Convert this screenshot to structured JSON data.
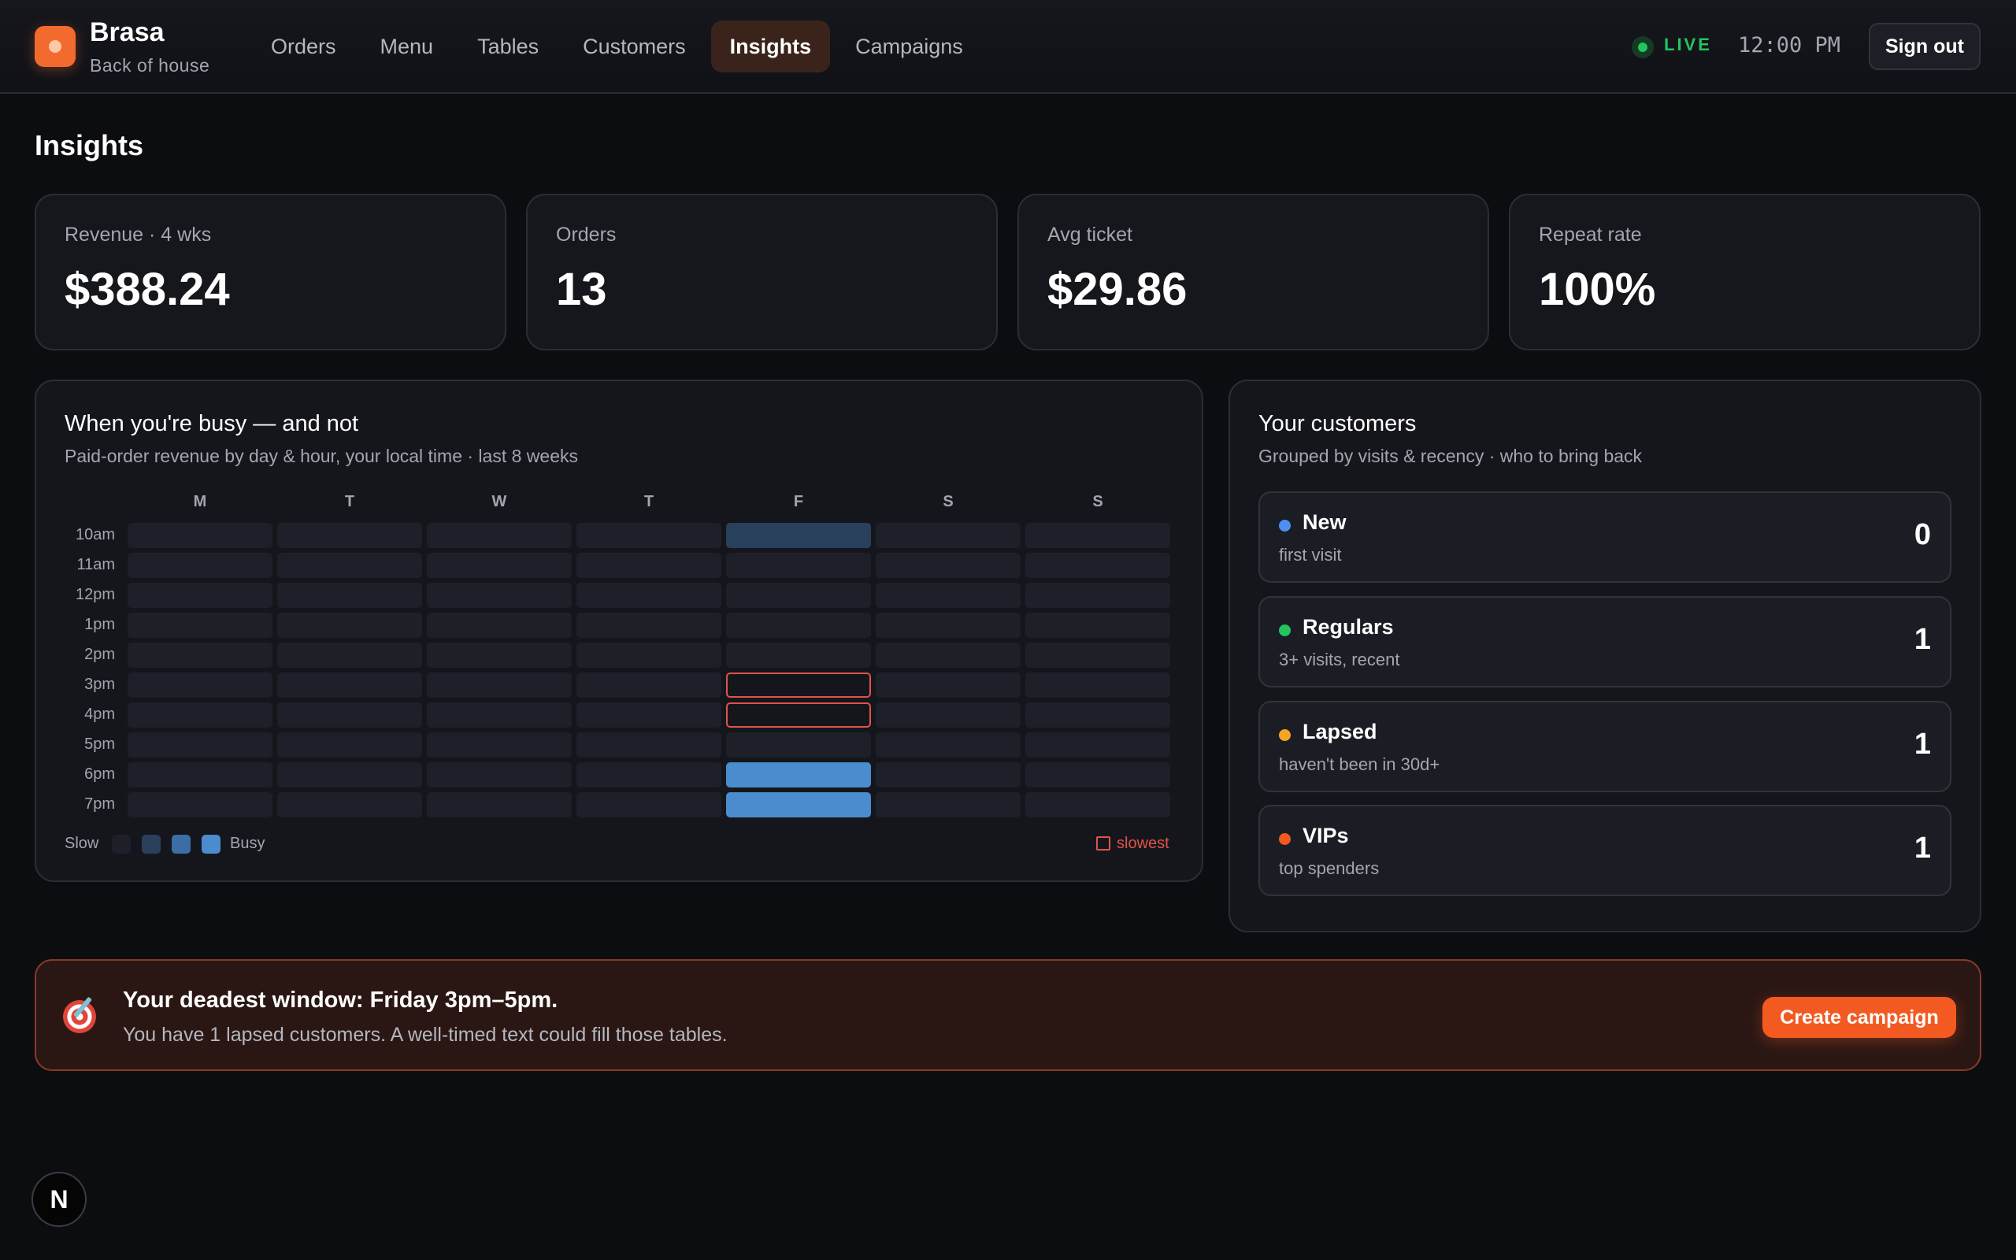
{
  "app": {
    "name": "Brasa",
    "subtitle": "Back of house"
  },
  "nav": {
    "items": [
      "Orders",
      "Menu",
      "Tables",
      "Customers",
      "Insights",
      "Campaigns"
    ],
    "active": "Insights"
  },
  "header": {
    "live_label": "LIVE",
    "time": "12:00 PM",
    "sign_out": "Sign out"
  },
  "page": {
    "title": "Insights"
  },
  "kpis": [
    {
      "label": "Revenue · 4 wks",
      "value": "$388.24"
    },
    {
      "label": "Orders",
      "value": "13"
    },
    {
      "label": "Avg ticket",
      "value": "$29.86"
    },
    {
      "label": "Repeat rate",
      "value": "100%"
    }
  ],
  "heatmap": {
    "title": "When you're busy — and not",
    "subtitle": "Paid-order revenue by day & hour, your local time · last 8 weeks",
    "days": [
      "M",
      "T",
      "W",
      "T",
      "F",
      "S",
      "S"
    ],
    "hours": [
      "10am",
      "11am",
      "12pm",
      "1pm",
      "2pm",
      "3pm",
      "4pm",
      "5pm",
      "6pm",
      "7pm"
    ],
    "levels": [
      [
        0,
        0,
        0,
        0,
        1,
        0,
        0
      ],
      [
        0,
        0,
        0,
        0,
        0,
        0,
        0
      ],
      [
        0,
        0,
        0,
        0,
        0,
        0,
        0
      ],
      [
        0,
        0,
        0,
        0,
        0,
        0,
        0
      ],
      [
        0,
        0,
        0,
        0,
        0,
        0,
        0
      ],
      [
        0,
        0,
        0,
        0,
        0,
        0,
        0
      ],
      [
        0,
        0,
        0,
        0,
        0,
        0,
        0
      ],
      [
        0,
        0,
        0,
        0,
        0,
        0,
        0
      ],
      [
        0,
        0,
        0,
        0,
        3,
        0,
        0
      ],
      [
        0,
        0,
        0,
        0,
        3,
        0,
        0
      ]
    ],
    "slowest_cells": [
      [
        5,
        4
      ],
      [
        6,
        4
      ]
    ],
    "legend": {
      "slow": "Slow",
      "busy": "Busy",
      "slowest": "slowest"
    },
    "colors": {
      "empty": "#1d2029",
      "low": "#29405c",
      "high": "#4a8cce",
      "slowest": "#e0534a"
    }
  },
  "customers": {
    "title": "Your customers",
    "subtitle": "Grouped by visits & recency · who to bring back",
    "segments": [
      {
        "name": "New",
        "desc": "first visit",
        "count": "0",
        "color": "#4f8ff0"
      },
      {
        "name": "Regulars",
        "desc": "3+ visits, recent",
        "count": "1",
        "color": "#22c55e"
      },
      {
        "name": "Lapsed",
        "desc": "haven't been in 30d+",
        "count": "1",
        "color": "#f5a524"
      },
      {
        "name": "VIPs",
        "desc": "top spenders",
        "count": "1",
        "color": "#f3591f"
      }
    ]
  },
  "banner": {
    "icon": "target-icon",
    "title": "Your deadest window: Friday 3pm–5pm.",
    "subtitle": "You have 1 lapsed customers. A well-timed text could fill those tables.",
    "cta": "Create campaign"
  },
  "fab": {
    "label": "N"
  },
  "colors": {
    "accent": "#f26a2e",
    "live": "#22c55e",
    "background": "#0c0d11"
  }
}
